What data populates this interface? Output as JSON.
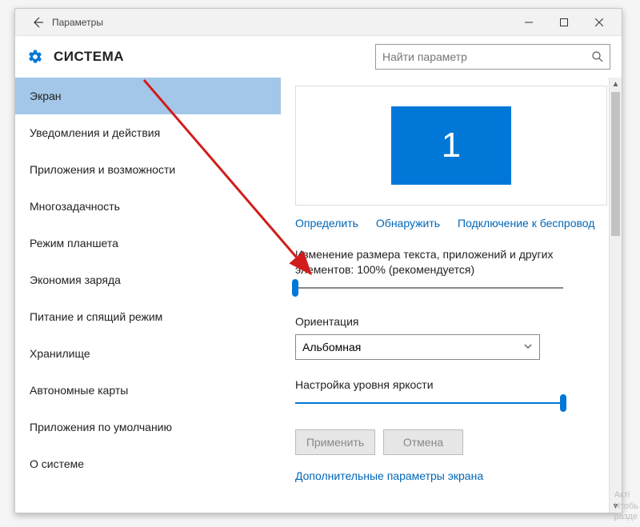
{
  "window": {
    "title": "Параметры",
    "section": "СИСТЕМА"
  },
  "search": {
    "placeholder": "Найти параметр"
  },
  "sidebar": {
    "items": [
      {
        "label": "Экран",
        "selected": true
      },
      {
        "label": "Уведомления и действия"
      },
      {
        "label": "Приложения и возможности"
      },
      {
        "label": "Многозадачность"
      },
      {
        "label": "Режим планшета"
      },
      {
        "label": "Экономия заряда"
      },
      {
        "label": "Питание и спящий режим"
      },
      {
        "label": "Хранилище"
      },
      {
        "label": "Автономные карты"
      },
      {
        "label": "Приложения по умолчанию"
      },
      {
        "label": "О системе"
      }
    ]
  },
  "display": {
    "monitor_number": "1",
    "links": {
      "identify": "Определить",
      "detect": "Обнаружить",
      "wireless": "Подключение к беспровод"
    },
    "scale_label": "Изменение размера текста, приложений и других элементов: 100% (рекомендуется)",
    "scale_percent": 0,
    "orientation_label": "Ориентация",
    "orientation_value": "Альбомная",
    "brightness_label": "Настройка уровня яркости",
    "brightness_percent": 100,
    "apply": "Применить",
    "cancel": "Отмена",
    "advanced_link": "Дополнительные параметры экрана"
  },
  "watermark": {
    "line1": "Акті",
    "line2": "Чтобь",
    "line3": "разде"
  }
}
